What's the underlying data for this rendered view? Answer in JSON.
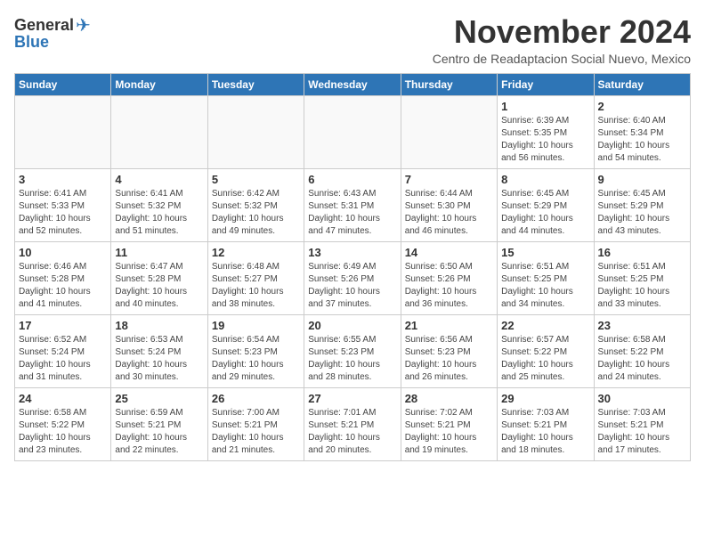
{
  "header": {
    "logo_general": "General",
    "logo_blue": "Blue",
    "month_title": "November 2024",
    "subtitle": "Centro de Readaptacion Social Nuevo, Mexico"
  },
  "days_of_week": [
    "Sunday",
    "Monday",
    "Tuesday",
    "Wednesday",
    "Thursday",
    "Friday",
    "Saturday"
  ],
  "weeks": [
    [
      {
        "day": "",
        "info": ""
      },
      {
        "day": "",
        "info": ""
      },
      {
        "day": "",
        "info": ""
      },
      {
        "day": "",
        "info": ""
      },
      {
        "day": "",
        "info": ""
      },
      {
        "day": "1",
        "info": "Sunrise: 6:39 AM\nSunset: 5:35 PM\nDaylight: 10 hours and 56 minutes."
      },
      {
        "day": "2",
        "info": "Sunrise: 6:40 AM\nSunset: 5:34 PM\nDaylight: 10 hours and 54 minutes."
      }
    ],
    [
      {
        "day": "3",
        "info": "Sunrise: 6:41 AM\nSunset: 5:33 PM\nDaylight: 10 hours and 52 minutes."
      },
      {
        "day": "4",
        "info": "Sunrise: 6:41 AM\nSunset: 5:32 PM\nDaylight: 10 hours and 51 minutes."
      },
      {
        "day": "5",
        "info": "Sunrise: 6:42 AM\nSunset: 5:32 PM\nDaylight: 10 hours and 49 minutes."
      },
      {
        "day": "6",
        "info": "Sunrise: 6:43 AM\nSunset: 5:31 PM\nDaylight: 10 hours and 47 minutes."
      },
      {
        "day": "7",
        "info": "Sunrise: 6:44 AM\nSunset: 5:30 PM\nDaylight: 10 hours and 46 minutes."
      },
      {
        "day": "8",
        "info": "Sunrise: 6:45 AM\nSunset: 5:29 PM\nDaylight: 10 hours and 44 minutes."
      },
      {
        "day": "9",
        "info": "Sunrise: 6:45 AM\nSunset: 5:29 PM\nDaylight: 10 hours and 43 minutes."
      }
    ],
    [
      {
        "day": "10",
        "info": "Sunrise: 6:46 AM\nSunset: 5:28 PM\nDaylight: 10 hours and 41 minutes."
      },
      {
        "day": "11",
        "info": "Sunrise: 6:47 AM\nSunset: 5:28 PM\nDaylight: 10 hours and 40 minutes."
      },
      {
        "day": "12",
        "info": "Sunrise: 6:48 AM\nSunset: 5:27 PM\nDaylight: 10 hours and 38 minutes."
      },
      {
        "day": "13",
        "info": "Sunrise: 6:49 AM\nSunset: 5:26 PM\nDaylight: 10 hours and 37 minutes."
      },
      {
        "day": "14",
        "info": "Sunrise: 6:50 AM\nSunset: 5:26 PM\nDaylight: 10 hours and 36 minutes."
      },
      {
        "day": "15",
        "info": "Sunrise: 6:51 AM\nSunset: 5:25 PM\nDaylight: 10 hours and 34 minutes."
      },
      {
        "day": "16",
        "info": "Sunrise: 6:51 AM\nSunset: 5:25 PM\nDaylight: 10 hours and 33 minutes."
      }
    ],
    [
      {
        "day": "17",
        "info": "Sunrise: 6:52 AM\nSunset: 5:24 PM\nDaylight: 10 hours and 31 minutes."
      },
      {
        "day": "18",
        "info": "Sunrise: 6:53 AM\nSunset: 5:24 PM\nDaylight: 10 hours and 30 minutes."
      },
      {
        "day": "19",
        "info": "Sunrise: 6:54 AM\nSunset: 5:23 PM\nDaylight: 10 hours and 29 minutes."
      },
      {
        "day": "20",
        "info": "Sunrise: 6:55 AM\nSunset: 5:23 PM\nDaylight: 10 hours and 28 minutes."
      },
      {
        "day": "21",
        "info": "Sunrise: 6:56 AM\nSunset: 5:23 PM\nDaylight: 10 hours and 26 minutes."
      },
      {
        "day": "22",
        "info": "Sunrise: 6:57 AM\nSunset: 5:22 PM\nDaylight: 10 hours and 25 minutes."
      },
      {
        "day": "23",
        "info": "Sunrise: 6:58 AM\nSunset: 5:22 PM\nDaylight: 10 hours and 24 minutes."
      }
    ],
    [
      {
        "day": "24",
        "info": "Sunrise: 6:58 AM\nSunset: 5:22 PM\nDaylight: 10 hours and 23 minutes."
      },
      {
        "day": "25",
        "info": "Sunrise: 6:59 AM\nSunset: 5:21 PM\nDaylight: 10 hours and 22 minutes."
      },
      {
        "day": "26",
        "info": "Sunrise: 7:00 AM\nSunset: 5:21 PM\nDaylight: 10 hours and 21 minutes."
      },
      {
        "day": "27",
        "info": "Sunrise: 7:01 AM\nSunset: 5:21 PM\nDaylight: 10 hours and 20 minutes."
      },
      {
        "day": "28",
        "info": "Sunrise: 7:02 AM\nSunset: 5:21 PM\nDaylight: 10 hours and 19 minutes."
      },
      {
        "day": "29",
        "info": "Sunrise: 7:03 AM\nSunset: 5:21 PM\nDaylight: 10 hours and 18 minutes."
      },
      {
        "day": "30",
        "info": "Sunrise: 7:03 AM\nSunset: 5:21 PM\nDaylight: 10 hours and 17 minutes."
      }
    ]
  ]
}
